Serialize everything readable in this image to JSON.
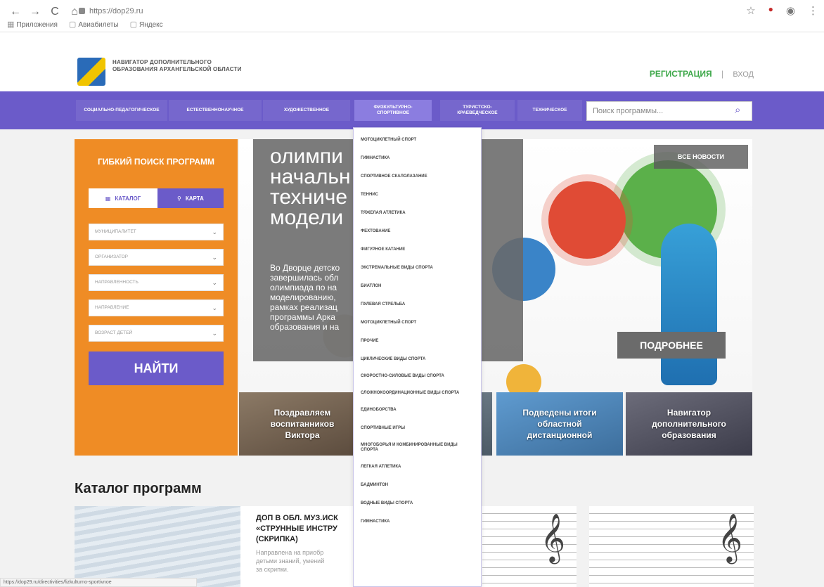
{
  "browser": {
    "url": "https://dop29.ru",
    "bookmarks": [
      "Приложения",
      "Авиабилеты",
      "Яндекс"
    ]
  },
  "header": {
    "logo_text": "НАВИГАТОР ДОПОЛНИТЕЛЬНОГО ОБРАЗОВАНИЯ АРХАНГЕЛЬСКОЙ ОБЛАСТИ",
    "register": "РЕГИСТРАЦИЯ",
    "separator": "|",
    "login": "ВХОД"
  },
  "nav": {
    "tabs": [
      {
        "label": "СОЦИАЛЬНО-ПЕДАГОГИЧЕСКОЕ"
      },
      {
        "label": "ЕСТЕСТВЕННОНАУЧНОЕ"
      },
      {
        "label": "ХУДОЖЕСТВЕННОЕ"
      },
      {
        "label": "ФИЗКУЛЬТУРНО-СПОРТИВНОЕ"
      },
      {
        "label": "ТУРИСТСКО-КРАЕВЕДЧЕСКОЕ"
      },
      {
        "label": "ТЕХНИЧЕСКОЕ"
      }
    ],
    "search_placeholder": "Поиск программы..."
  },
  "filter": {
    "title": "ГИБКИЙ ПОИСК ПРОГРАММ",
    "tab_catalog": "КАТАЛОГ",
    "tab_map": "КАРТА",
    "selects": [
      "МУНИЦИПАЛИТЕТ",
      "ОРГАНИЗАТОР",
      "НАПРАВЛЕННОСТЬ",
      "НАПРАВЛЕНИЕ",
      "ВОЗРАСТ ДЕТЕЙ"
    ],
    "find_button": "НАЙТИ"
  },
  "hero": {
    "title": "олимпи\nначальн\nтехниче\nмодели",
    "text": "Во Дворце детско\nзавершилась обл\nолимпиада по на\nмоделированию,\nрамках реализац\nпрограммы Арка\nобразования и на",
    "all_news": "ВСЕ НОВОСТИ",
    "more": "ПОДРОБНЕЕ"
  },
  "news_tiles": [
    {
      "text": "Поздравляем\nвоспитанников\nВиктора"
    },
    {
      "text": ""
    },
    {
      "text": "Подведены итоги\nобластной\nдистанционной"
    },
    {
      "text": "Навигатор\nдополнительного\nобразования"
    }
  ],
  "catalog": {
    "title": "Каталог программ",
    "card1_title": "ДОП В ОБЛ. МУЗ.ИСК\n«СТРУННЫЕ ИНСТРУ\n(СКРИПКА)",
    "card1_desc": "Направлена на приобр\nдетьми знаний, умений\nза скрипки."
  },
  "dropdown": {
    "items": [
      "МОТОЦИКЛЕТНЫЙ СПОРТ",
      "ГИМНАСТИКА",
      "СПОРТИВНОЕ СКАЛОЛАЗАНИЕ",
      "ТЕННИС",
      "ТЯЖЕЛАЯ АТЛЕТИКА",
      "ФЕХТОВАНИЕ",
      "ФИГУРНОЕ КАТАНИЕ",
      "ЭКСТРЕМАЛЬНЫЕ ВИДЫ СПОРТА",
      "БИАТЛОН",
      "ПУЛЕВАЯ СТРЕЛЬБА",
      "МОТОЦИКЛЕТНЫЙ СПОРТ",
      "ПРОЧИЕ",
      "ЦИКЛИЧЕСКИЕ ВИДЫ СПОРТА",
      "СКОРОСТНО-СИЛОВЫЕ ВИДЫ СПОРТА",
      "СЛОЖНОКООРДИНАЦИОННЫЕ ВИДЫ СПОРТА",
      "ЕДИНОБОРСТВА",
      "СПОРТИВНЫЕ ИГРЫ",
      "МНОГОБОРЬЯ И КОМБИНИРОВАННЫЕ ВИДЫ СПОРТА",
      "ЛЕГКАЯ АТЛЕТИКА",
      "БАДМИНТОН",
      "ВОДНЫЕ ВИДЫ СПОРТА",
      "ГИМНАСТИКА"
    ]
  },
  "status_bar": "https://dop29.ru/directivities/fizkulturno-sportivnoe"
}
